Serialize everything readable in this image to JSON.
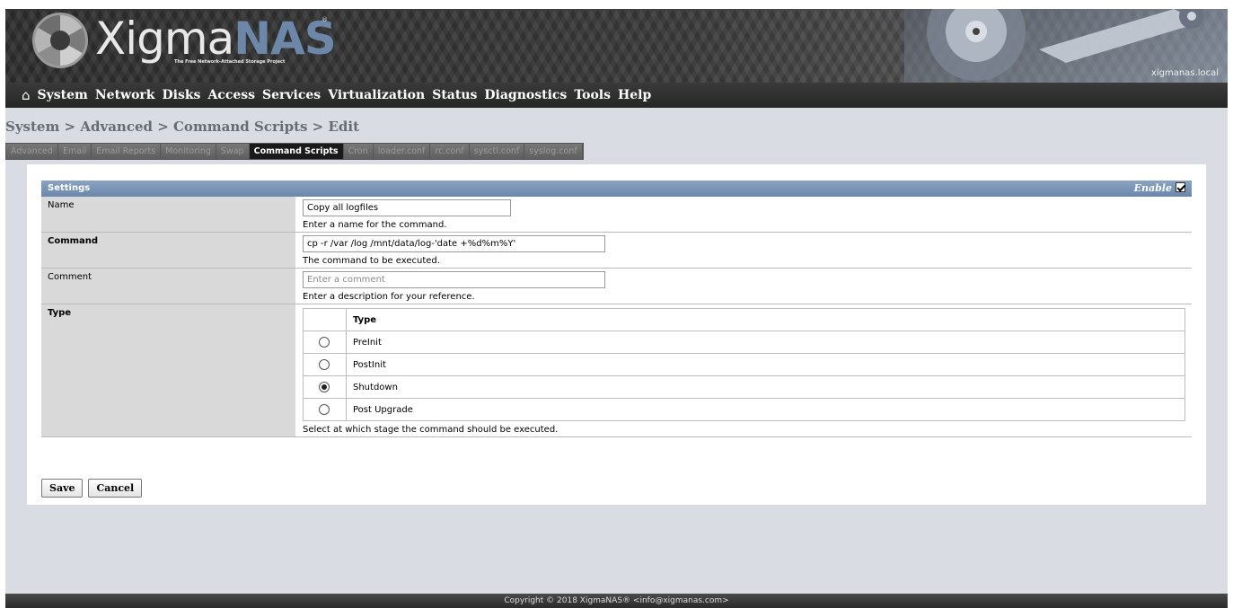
{
  "header": {
    "logo_text_a": "Xigma",
    "logo_text_b": "NAS",
    "logo_reg": "®",
    "tagline": "The Free Network-Attached Storage Project",
    "hostname": "xigmanas.local"
  },
  "nav": {
    "home_icon": "home-icon",
    "items": [
      "System",
      "Network",
      "Disks",
      "Access",
      "Services",
      "Virtualization",
      "Status",
      "Diagnostics",
      "Tools",
      "Help"
    ]
  },
  "breadcrumb": "System > Advanced > Command Scripts > Edit",
  "tabs": [
    "Advanced",
    "Email",
    "Email Reports",
    "Monitoring",
    "Swap",
    "Command Scripts",
    "Cron",
    "loader.conf",
    "rc.conf",
    "sysctl.conf",
    "syslog.conf"
  ],
  "active_tab": "Command Scripts",
  "settings": {
    "title": "Settings",
    "enable_label": "Enable",
    "enable_checked": true,
    "name": {
      "label": "Name",
      "value": "Copy all logfiles",
      "description": "Enter a name for the command."
    },
    "command": {
      "label": "Command",
      "value": "cp -r /var /log /mnt/data/log-'date +%d%m%Y'",
      "description": "The command to be executed."
    },
    "comment": {
      "label": "Comment",
      "placeholder": "Enter a comment",
      "description": "Enter a description for your reference."
    },
    "type": {
      "label": "Type",
      "column_header": "Type",
      "options": [
        {
          "label": "PreInit",
          "selected": false
        },
        {
          "label": "PostInit",
          "selected": false
        },
        {
          "label": "Shutdown",
          "selected": true
        },
        {
          "label": "Post Upgrade",
          "selected": false
        }
      ],
      "description": "Select at which stage the command should be executed."
    }
  },
  "buttons": {
    "save": "Save",
    "cancel": "Cancel"
  },
  "footer": "Copyright © 2018 XigmaNAS® <info@xigmanas.com>",
  "colors": {
    "section_header": "#6b87ab",
    "nav_bg": "#262626",
    "page_bg": "#d9dde3"
  }
}
